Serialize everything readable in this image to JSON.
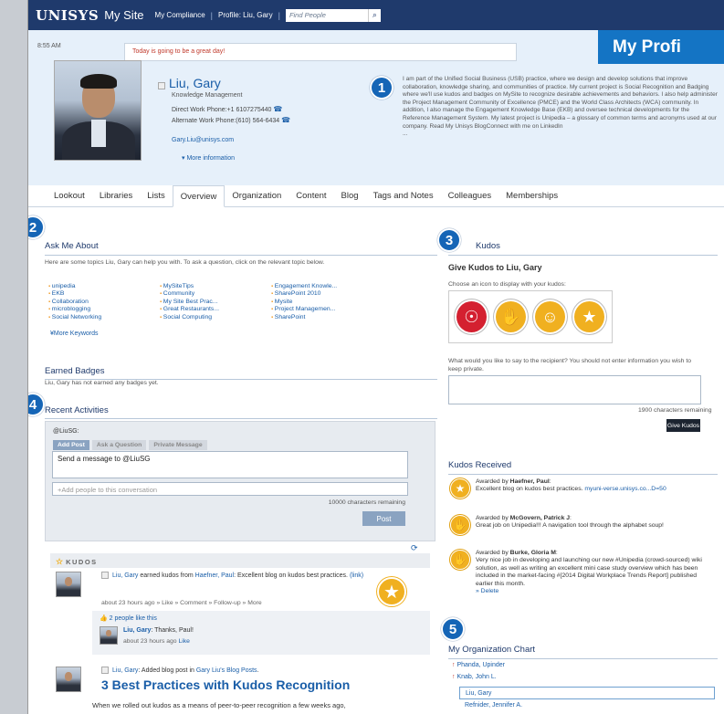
{
  "topbar": {
    "logo": "UNISYS",
    "site": "My Site",
    "compliance": "My Compliance",
    "profile_link": "Profile: Liu, Gary",
    "search_placeholder": "Find People"
  },
  "header": {
    "time": "8:55 AM",
    "status": "Today is going to be a great day!",
    "page_title": "My Profi",
    "name": "Liu, Gary",
    "dept": "Knowledge Management",
    "direct_phone": "Direct Work Phone:+1 6107275440",
    "alt_phone": "Alternate Work Phone:(610) 564-6434",
    "email": "Gary.Liu@unisys.com",
    "more_info": "More information",
    "bio": "I am part of the Unified Social Business (USB) practice, where we design and develop solutions that improve collaboration, knowledge sharing, and communities of practice. My current project is Social Recognition and Badging where we'll use kudos and badges on MySite to recognize desirable achievements and behaviors. I also help administer the Project Management Community of Excellence (PMCE) and the World Class Architects (WCA) community. In addition, I also manage the Engagement Knowledge Base (EKB) and oversee technical developments for the Reference Management System. My latest project is Unipedia – a glossary of common terms and acronyms used at our company. Read My Unisys BlogConnect with me on LinkedIn",
    "bio_more": "..."
  },
  "callouts": [
    "1",
    "2",
    "3",
    "4",
    "5"
  ],
  "tabs": [
    "Lookout",
    "Libraries",
    "Lists",
    "Overview",
    "Organization",
    "Content",
    "Blog",
    "Tags and Notes",
    "Colleagues",
    "Memberships"
  ],
  "ask": {
    "title": "Ask Me About",
    "desc": "Here are some topics Liu, Gary can help you with. To ask a question, click on the relevant topic below.",
    "col1": [
      "unipedia",
      "EKB",
      "Collaboration",
      "microblogging",
      "Social Networking"
    ],
    "col2": [
      "MySiteTips",
      "Community",
      "My Site Best Prac...",
      "Great Restaurants...",
      "Social Computing"
    ],
    "col3": [
      "Engagement Knowle...",
      "SharePoint 2010",
      "Mysite",
      "Project Managemen...",
      "SharePoint"
    ],
    "more": "More Keywords"
  },
  "badges": {
    "title": "Earned Badges",
    "text": "Liu, Gary has not earned any badges yet."
  },
  "activities": {
    "title": "Recent Activities",
    "user": "@LiuSG:",
    "tabs": [
      "Add Post",
      "Ask a Question",
      "Private Message"
    ],
    "message": "Send a message to @LiuSG",
    "add_people": "+Add people to this conversation",
    "chars": "10000 characters remaining",
    "post": "Post",
    "feed_head": "KUDOS",
    "feed1_user": "Liu, Gary",
    "feed1_mid": " earned kudos from ",
    "feed1_from": "Haefner, Paul",
    "feed1_rest": ": Excellent blog on kudos best practices.",
    "feed1_link": "(link)",
    "feed1_meta": "about 23 hours ago  » Like  » Comment  » Follow-up  » More",
    "likes": "2 people like this",
    "reply_user": "Liu, Gary",
    "reply_text": ": Thanks, Paul!",
    "reply_meta": "about 23 hours ago",
    "reply_like": "Like",
    "feed2_user": "Liu, Gary",
    "feed2_mid": ": Added blog post in ",
    "feed2_blog": "Gary Liu's Blog Posts",
    "feed2_end": ".",
    "feed2_title": "3 Best Practices with Kudos Recognition",
    "feed2_text": "When we rolled out kudos as a means of peer-to-peer recognition a few weeks ago,"
  },
  "kudos": {
    "title": "Kudos",
    "give_title": "Give Kudos to Liu, Gary",
    "choose": "Choose an icon to display with your kudos:",
    "say": "What would you like to say to the recipient? You should not enter information you wish to keep private.",
    "chars": "1900 characters remaining",
    "give_btn": "Give Kudos",
    "icon_colors": [
      "#d42030",
      "#f0b020",
      "#f0b020",
      "#f0b020"
    ]
  },
  "received": {
    "title": "Kudos Received",
    "items": [
      {
        "pre": "Awarded by ",
        "by": "Haefner, Paul",
        "text": "Excellent blog on kudos best practices. ",
        "link": "myuni-verse.unisys.co...D=50"
      },
      {
        "pre": "Awarded by ",
        "by": "McGovern, Patrick J",
        "text": "Great job on Unipedia!!! A navigation tool through the alphabet soup!",
        "link": ""
      },
      {
        "pre": "Awarded by ",
        "by": "Burke, Gloria M",
        "text": "Very nice job in developing and launching our new #Unipedia (crowd-sourced) wiki solution, as well as writing an excellent mini case study overview which has been included in the market-facing #[2014 Digital Workplace Trends Report] published earlier this month.",
        "link": "Delete"
      }
    ]
  },
  "org": {
    "title": "My Organization Chart",
    "people": [
      "Phanda, Upinder",
      "Knab, John L.",
      "Liu, Gary",
      "Refnider, Jennifer A."
    ]
  }
}
